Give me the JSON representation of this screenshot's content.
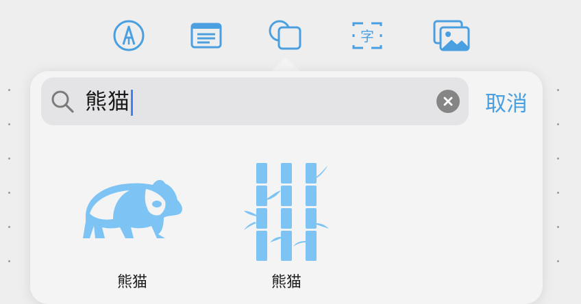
{
  "toolbar": {
    "tools": [
      {
        "name": "draw-tool",
        "icon": "pen-nib-circle-icon"
      },
      {
        "name": "text-box-tool",
        "icon": "text-box-icon"
      },
      {
        "name": "shapes-tool",
        "icon": "shapes-icon",
        "selected": true
      },
      {
        "name": "text-frame-tool",
        "icon": "text-frame-zi-icon",
        "glyph": "字"
      },
      {
        "name": "images-tool",
        "icon": "photos-icon"
      }
    ]
  },
  "search": {
    "value": "熊猫",
    "cancel_label": "取消"
  },
  "results": [
    {
      "label": "熊猫",
      "icon": "panda-icon"
    },
    {
      "label": "熊猫",
      "icon": "bamboo-icon"
    }
  ],
  "colors": {
    "accent": "#4a9fe0",
    "shape_fill": "#7dc4f5",
    "background": "#eeeeee",
    "popover": "#f4f4f4",
    "search_field": "#e4e4e6"
  }
}
